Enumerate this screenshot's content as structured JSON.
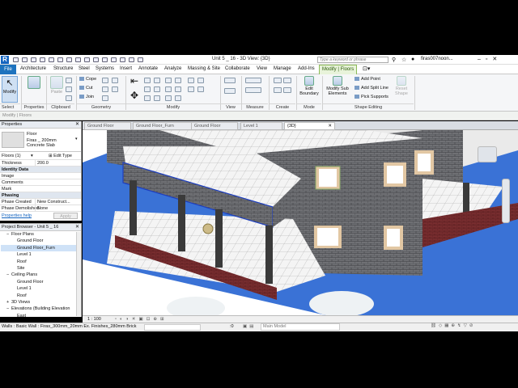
{
  "app": {
    "title": "Unit 5 _ 16 - 3D View: {3D}",
    "search_placeholder": "Type a keyword or phrase",
    "user": "firas007noon...",
    "logo": "R"
  },
  "tabs": [
    "File",
    "Architecture",
    "Structure",
    "Steel",
    "Systems",
    "Insert",
    "Annotate",
    "Analyze",
    "Massing & Site",
    "Collaborate",
    "View",
    "Manage",
    "Add-Ins",
    "Modify | Floors"
  ],
  "ribbon": {
    "modify": "Modify",
    "select": "Select",
    "properties": "Properties",
    "clipboard": "Clipboard",
    "geometry": "Geometry",
    "modify_panel": "Modify",
    "view": "View",
    "measure": "Measure",
    "create": "Create",
    "mode": "Mode",
    "shape_editing": "Shape Editing",
    "cope": "Cope",
    "cut": "Cut",
    "join": "Join",
    "paste": "Paste",
    "edit_boundary": "Edit Boundary",
    "modify_sub_elements": "Modify Sub Elements",
    "add_point": "Add Point",
    "add_split_line": "Add Split Line",
    "pick_supports": "Pick Supports",
    "reset_shape": "Reset Shape"
  },
  "options_bar": "Modify | Floors",
  "properties": {
    "header": "Properties",
    "type_family": "Floor",
    "type_name": "Firas _ 200mm Concrete Slab",
    "instance_selector": "Floors (1)",
    "edit_type": "Edit Type",
    "rows": [
      {
        "label": "Thickness",
        "value": "200.0",
        "group": false
      },
      {
        "label": "Identity Data",
        "value": "",
        "group": true
      },
      {
        "label": "Image",
        "value": "",
        "group": false
      },
      {
        "label": "Comments",
        "value": "",
        "group": false
      },
      {
        "label": "Mark",
        "value": "",
        "group": false
      },
      {
        "label": "Phasing",
        "value": "",
        "group": true
      },
      {
        "label": "Phase Created",
        "value": "New Construct...",
        "group": false
      },
      {
        "label": "Phase Demolished",
        "value": "None",
        "group": false
      }
    ],
    "help": "Properties help",
    "apply": "Apply"
  },
  "project_browser": {
    "header": "Project Browser - Unit 5 _ 16",
    "items": [
      {
        "label": "Floor Plans",
        "indent": 1,
        "expander": "−"
      },
      {
        "label": "Ground Floor",
        "indent": 2,
        "expander": ""
      },
      {
        "label": "Ground Floor_Furn",
        "indent": 2,
        "expander": ""
      },
      {
        "label": "Level 1",
        "indent": 2,
        "expander": ""
      },
      {
        "label": "Roof",
        "indent": 2,
        "expander": ""
      },
      {
        "label": "Site",
        "indent": 2,
        "expander": ""
      },
      {
        "label": "Ceiling Plans",
        "indent": 1,
        "expander": "−"
      },
      {
        "label": "Ground Floor",
        "indent": 2,
        "expander": ""
      },
      {
        "label": "Level 1",
        "indent": 2,
        "expander": ""
      },
      {
        "label": "Roof",
        "indent": 2,
        "expander": ""
      },
      {
        "label": "3D Views",
        "indent": 1,
        "expander": "+"
      },
      {
        "label": "Elevations (Building Elevation",
        "indent": 1,
        "expander": "−"
      },
      {
        "label": "East",
        "indent": 2,
        "expander": ""
      }
    ]
  },
  "doc_tabs": [
    "Ground Floor",
    "Ground Floor_Furn",
    "Ground Floor",
    "Level 1",
    "{3D}"
  ],
  "view_control": {
    "scale": "1 : 100"
  },
  "status": {
    "text": "Walls : Basic Wall : Firas_300mm_20mm Ex. Finishes_280mm Brick",
    "zero": ":0",
    "model": "Main Model"
  }
}
